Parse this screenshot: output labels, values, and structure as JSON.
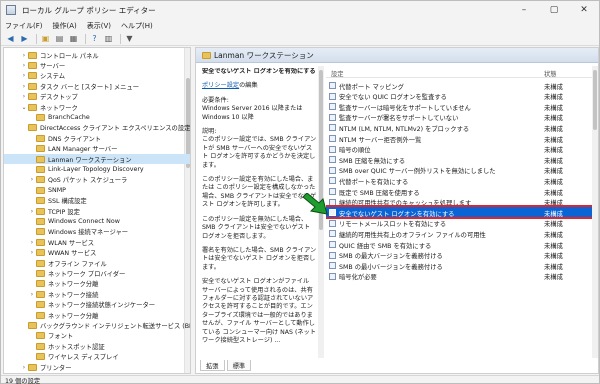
{
  "window": {
    "title": "ローカル グループ ポリシー エディター"
  },
  "menu": [
    "ファイル(F)",
    "操作(A)",
    "表示(V)",
    "ヘルプ(H)"
  ],
  "tree": [
    {
      "label": "コントロール パネル",
      "indent": 2,
      "expander": "›"
    },
    {
      "label": "サーバー",
      "indent": 2,
      "expander": "›"
    },
    {
      "label": "システム",
      "indent": 2,
      "expander": "›"
    },
    {
      "label": "タスク バーと [スタート] メニュー",
      "indent": 2,
      "expander": "›"
    },
    {
      "label": "デスクトップ",
      "indent": 2,
      "expander": "›"
    },
    {
      "label": "ネットワーク",
      "indent": 2,
      "expander": "⌄"
    },
    {
      "label": "BranchCache",
      "indent": 3,
      "expander": ""
    },
    {
      "label": "DirectAccess クライアント エクスペリエンスの設定",
      "indent": 3,
      "expander": ""
    },
    {
      "label": "DNS クライアント",
      "indent": 3,
      "expander": ""
    },
    {
      "label": "LAN Manager サーバー",
      "indent": 3,
      "expander": ""
    },
    {
      "label": "Lanman ワークステーション",
      "indent": 3,
      "expander": "",
      "selected": true
    },
    {
      "label": "Link-Layer Topology Discovery",
      "indent": 3,
      "expander": ""
    },
    {
      "label": "QoS パケット スケジューラ",
      "indent": 3,
      "expander": "›"
    },
    {
      "label": "SNMP",
      "indent": 3,
      "expander": ""
    },
    {
      "label": "SSL 構成設定",
      "indent": 3,
      "expander": ""
    },
    {
      "label": "TCPIP 設定",
      "indent": 3,
      "expander": "›"
    },
    {
      "label": "Windows Connect Now",
      "indent": 3,
      "expander": ""
    },
    {
      "label": "Windows 接続マネージャー",
      "indent": 3,
      "expander": ""
    },
    {
      "label": "WLAN サービス",
      "indent": 3,
      "expander": "›"
    },
    {
      "label": "WWAN サービス",
      "indent": 3,
      "expander": "›"
    },
    {
      "label": "オフライン ファイル",
      "indent": 3,
      "expander": ""
    },
    {
      "label": "ネットワーク プロバイダー",
      "indent": 3,
      "expander": ""
    },
    {
      "label": "ネットワーク分離",
      "indent": 3,
      "expander": ""
    },
    {
      "label": "ネットワーク接続",
      "indent": 3,
      "expander": "›"
    },
    {
      "label": "ネットワーク接続状態インジケーター",
      "indent": 3,
      "expander": ""
    },
    {
      "label": "ネットワーク分離",
      "indent": 3,
      "expander": ""
    },
    {
      "label": "バックグラウンド インテリジェント転送サービス (BITS)",
      "indent": 3,
      "expander": ""
    },
    {
      "label": "フォント",
      "indent": 3,
      "expander": ""
    },
    {
      "label": "ホットスポット認証",
      "indent": 3,
      "expander": ""
    },
    {
      "label": "ワイヤレス ディスプレイ",
      "indent": 3,
      "expander": ""
    },
    {
      "label": "プリンター",
      "indent": 2,
      "expander": "›"
    }
  ],
  "right": {
    "header": "Lanman ワークステーション",
    "desc": {
      "title": "安全でないゲスト ログオンを有効にする",
      "link": "ポリシー設定",
      "link_suffix": "の編集",
      "req": "必要条件:\nWindows Server 2016 以降または Windows 10 以降",
      "explain": "説明:\nこのポリシー設定では、SMB クライアントが SMB サーバーへの安全でないゲスト ログオンを許可するかどうかを決定します。",
      "p2": "このポリシー設定を有効にした場合、または このポリシー設定を構成しなかった場合、SMB クライアントは安全でないゲスト ログオンを許可します。",
      "p3": "このポリシー設定を無効にした場合、SMB クライアントは安全でないゲスト ログオンを拒否します。",
      "p4": "署名を有効にした場合、SMB クライアントは安全でないゲスト ログオンを拒否します。",
      "p5": "安全でないゲスト ログオンがファイル サーバーによって使用されるのは、共有フォルダーに対する認証されていないアクセスを許可することが目的です。エンタープライズ環境では一般的ではありませんが、ファイル サーバーとして動作している コンシューマー向け NAS (ネットワーク接続型ストレージ) ..."
    },
    "columns": {
      "setting": "設定",
      "state": "状態"
    },
    "rows": [
      {
        "name": "代替ポート マッピング",
        "state": "未構成"
      },
      {
        "name": "安全でない QUIC ログオンを監査する",
        "state": "未構成"
      },
      {
        "name": "監査サーバーは暗号化をサポートしていません",
        "state": "未構成"
      },
      {
        "name": "監査サーバーが署名をサポートしていない",
        "state": "未構成"
      },
      {
        "name": "NTLM (LM, NTLM, NTLMv2) をブロックする",
        "state": "未構成"
      },
      {
        "name": "NTLM サーバー拒否例外一覧",
        "state": "未構成"
      },
      {
        "name": "暗号の順位",
        "state": "未構成"
      },
      {
        "name": "SMB 圧縮を無効にする",
        "state": "未構成"
      },
      {
        "name": "SMB over QUIC サーバー例外リストを無効にしました",
        "state": "未構成"
      },
      {
        "name": "代替ポートを有効にする",
        "state": "未構成"
      },
      {
        "name": "既定で SMB 圧縮を使用する",
        "state": "未構成"
      },
      {
        "name": "継続的可用性共有でのキャッシュを処理します",
        "state": "未構成"
      },
      {
        "name": "安全でないゲスト ログオンを有効にする",
        "state": "未構成",
        "selected": true
      },
      {
        "name": "リモートメールスロットを有効にする",
        "state": "未構成"
      },
      {
        "name": "継続的可用性共有上のオフライン ファイルの可用性",
        "state": "未構成"
      },
      {
        "name": "QUIC 経由で SMB を有効にする",
        "state": "未構成"
      },
      {
        "name": "SMB の最大バージョンを義務付ける",
        "state": "未構成"
      },
      {
        "name": "SMB の最小バージョンを義務付ける",
        "state": "未構成"
      },
      {
        "name": "暗号化が必要",
        "state": "未構成"
      }
    ]
  },
  "tabs": [
    "拡張",
    "標準"
  ],
  "status": "19 個の設定",
  "colors": {
    "select": "#0a64d6",
    "highlight": "#e0242c",
    "arrow": "#1f9e2f"
  }
}
